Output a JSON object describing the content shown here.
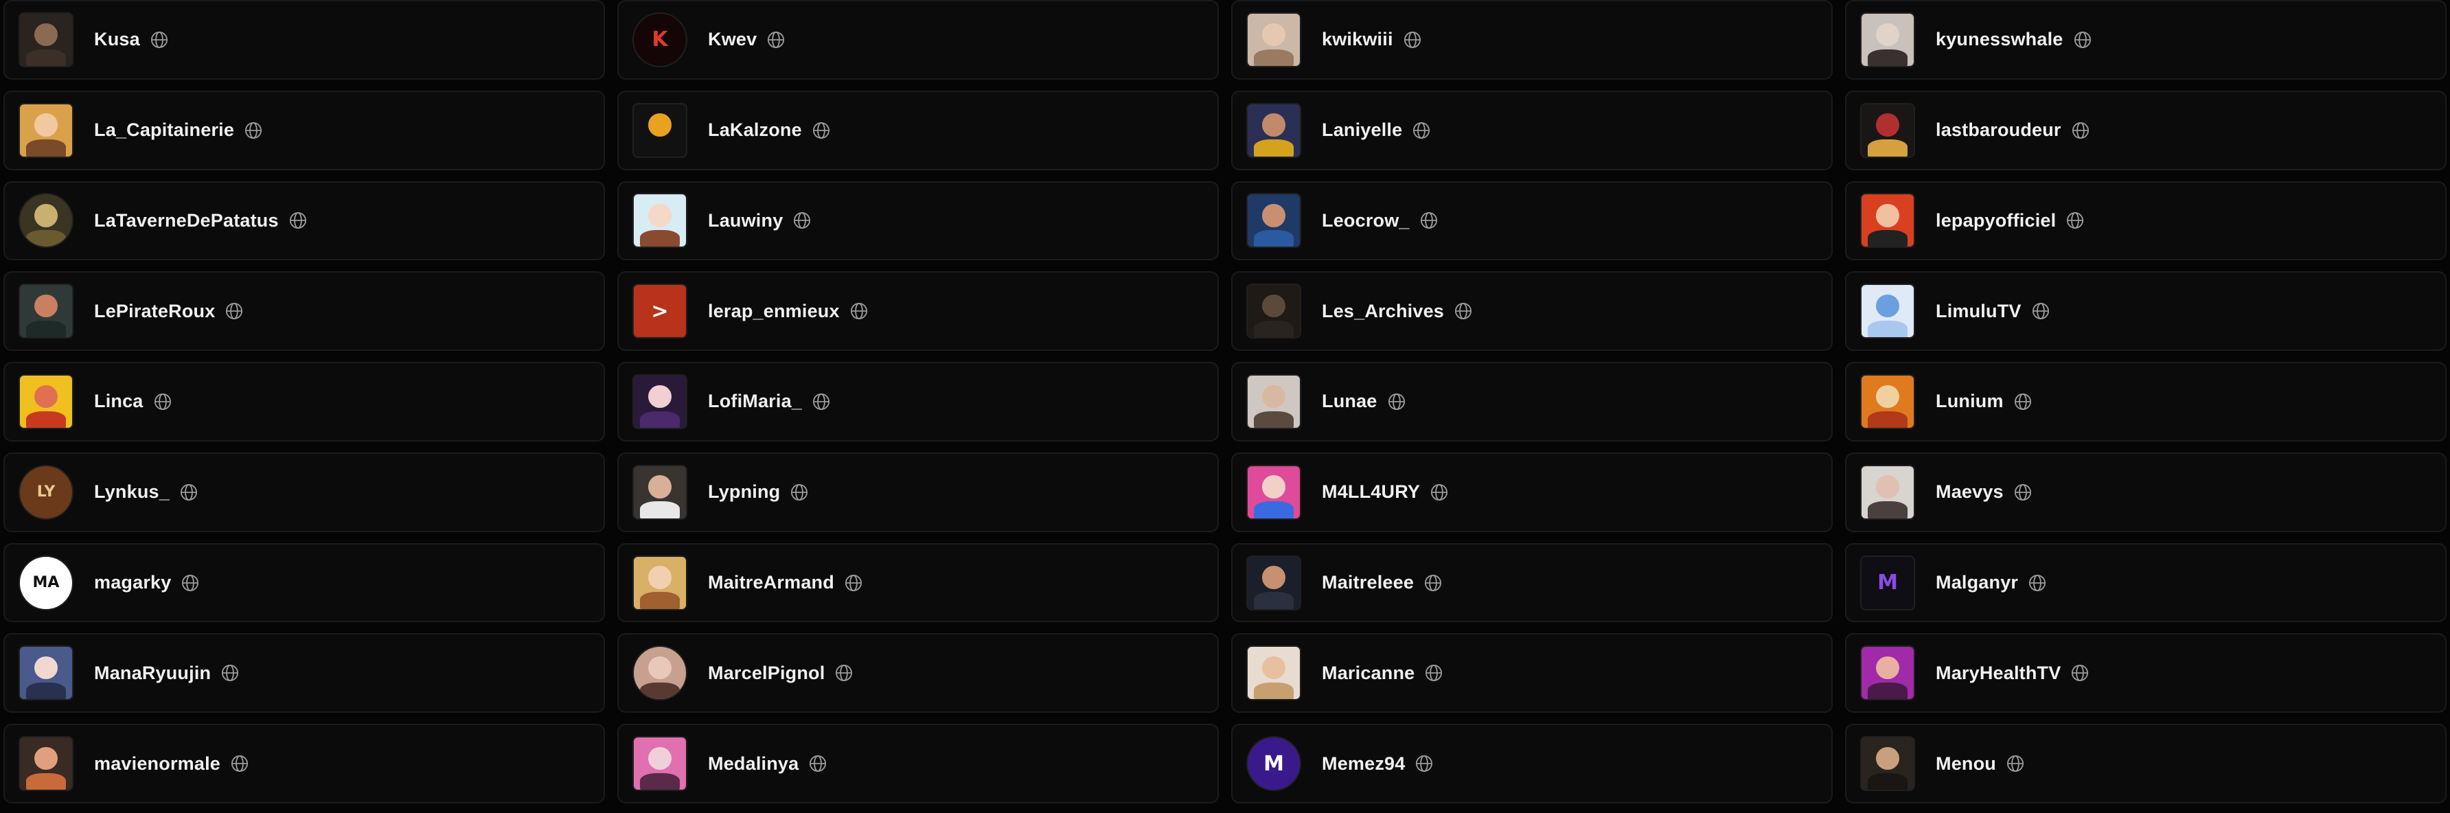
{
  "colors": {
    "page_background": "#050505",
    "card_background": "#0b0b0b",
    "card_border": "#1b1b1b",
    "text": "#f1f1f1",
    "globe_icon": "#9a9a9a"
  },
  "streamers": [
    {
      "name": "Kusa",
      "avatar": {
        "bg": "#2a2420",
        "face": "#8a6a50",
        "body": "#3b2f28",
        "round": false,
        "glyph": ""
      }
    },
    {
      "name": "Kwev",
      "avatar": {
        "bg": "#140606",
        "face": "",
        "body": "",
        "round": true,
        "glyph": "K",
        "glyph_color": "#e0392b"
      }
    },
    {
      "name": "kwikwiii",
      "avatar": {
        "bg": "#cbb8a8",
        "face": "#e6c8b0",
        "body": "#9a7b62",
        "round": false,
        "glyph": ""
      }
    },
    {
      "name": "kyunesswhale",
      "avatar": {
        "bg": "#c9c1bb",
        "face": "#e2d3c8",
        "body": "#3a3030",
        "round": false,
        "glyph": ""
      }
    },
    {
      "name": "La_Capitainerie",
      "avatar": {
        "bg": "#d9a24a",
        "face": "#f0c9a0",
        "body": "#7a4a2a",
        "round": false,
        "glyph": ""
      }
    },
    {
      "name": "LaKalzone",
      "avatar": {
        "bg": "#111111",
        "face": "#e8a21f",
        "body": "",
        "round": false,
        "glyph": ""
      }
    },
    {
      "name": "Laniyelle",
      "avatar": {
        "bg": "#2b2f55",
        "face": "#c28a6a",
        "body": "#d4a21f",
        "round": false,
        "glyph": ""
      }
    },
    {
      "name": "lastbaroudeur",
      "avatar": {
        "bg": "#1a1616",
        "face": "#b03030",
        "body": "#d4a040",
        "round": false,
        "glyph": ""
      }
    },
    {
      "name": "LaTaverneDePatatus",
      "avatar": {
        "bg": "#3a3422",
        "face": "#c8b070",
        "body": "#6a5a30",
        "round": true,
        "glyph": ""
      }
    },
    {
      "name": "Lauwiny",
      "avatar": {
        "bg": "#d8ecf4",
        "face": "#f5d8c8",
        "body": "#8a4a30",
        "round": false,
        "glyph": ""
      }
    },
    {
      "name": "Leocrow_",
      "avatar": {
        "bg": "#1f3a66",
        "face": "#c89070",
        "body": "#2a5aa0",
        "round": false,
        "glyph": ""
      }
    },
    {
      "name": "lepapyofficiel",
      "avatar": {
        "bg": "#d8401f",
        "face": "#f0c0a0",
        "body": "#222222",
        "round": false,
        "glyph": ""
      }
    },
    {
      "name": "LePirateRoux",
      "avatar": {
        "bg": "#2f3a38",
        "face": "#c88060",
        "body": "#1d2a28",
        "round": false,
        "glyph": ""
      }
    },
    {
      "name": "lerap_enmieux",
      "avatar": {
        "bg": "#b8321c",
        "face": "",
        "body": "",
        "round": false,
        "glyph": ">",
        "glyph_color": "#ffffff"
      }
    },
    {
      "name": "Les_Archives",
      "avatar": {
        "bg": "#1e1a16",
        "face": "#5a4a3a",
        "body": "#2a2420",
        "round": false,
        "glyph": ""
      }
    },
    {
      "name": "LimuluTV",
      "avatar": {
        "bg": "#dfeaf6",
        "face": "#6aa0e0",
        "body": "#a8c8f0",
        "round": false,
        "glyph": ""
      }
    },
    {
      "name": "Linca",
      "avatar": {
        "bg": "#f0c020",
        "face": "#e07050",
        "body": "#c83a20",
        "round": false,
        "glyph": ""
      }
    },
    {
      "name": "LofiMaria_",
      "avatar": {
        "bg": "#2a1a3a",
        "face": "#f0d0d0",
        "body": "#4a2a6a",
        "round": false,
        "glyph": ""
      }
    },
    {
      "name": "Lunae",
      "avatar": {
        "bg": "#cfc8c2",
        "face": "#d8b8a0",
        "body": "#5a4a40",
        "round": false,
        "glyph": ""
      }
    },
    {
      "name": "Lunium",
      "avatar": {
        "bg": "#e07a1f",
        "face": "#f0d0a0",
        "body": "#b03a1a",
        "round": false,
        "glyph": ""
      }
    },
    {
      "name": "Lynkus_",
      "avatar": {
        "bg": "#6a3a1a",
        "face": "",
        "body": "",
        "round": true,
        "glyph": "LY",
        "glyph_color": "#e8c890"
      }
    },
    {
      "name": "Lypning",
      "avatar": {
        "bg": "#3a3430",
        "face": "#d8b098",
        "body": "#e8e8e8",
        "round": false,
        "glyph": ""
      }
    },
    {
      "name": "M4LL4URY",
      "avatar": {
        "bg": "#e04a9a",
        "face": "#f0d0c8",
        "body": "#3a6ae0",
        "round": false,
        "glyph": ""
      }
    },
    {
      "name": "Maevys",
      "avatar": {
        "bg": "#d8d4d0",
        "face": "#e0c0b0",
        "body": "#4a4040",
        "round": false,
        "glyph": ""
      }
    },
    {
      "name": "magarky",
      "avatar": {
        "bg": "#ffffff",
        "face": "",
        "body": "",
        "round": true,
        "glyph": "MA",
        "glyph_color": "#111111"
      }
    },
    {
      "name": "MaitreArmand",
      "avatar": {
        "bg": "#d8b068",
        "face": "#f0d0b0",
        "body": "#a06030",
        "round": false,
        "glyph": ""
      }
    },
    {
      "name": "Maitreleee",
      "avatar": {
        "bg": "#1a1f2a",
        "face": "#c89070",
        "body": "#2a3040",
        "round": false,
        "glyph": ""
      }
    },
    {
      "name": "Malganyr",
      "avatar": {
        "bg": "#0e0e14",
        "face": "",
        "body": "",
        "round": false,
        "glyph": "M",
        "glyph_color": "#8a4ae8"
      }
    },
    {
      "name": "ManaRyuujin",
      "avatar": {
        "bg": "#4a5a8a",
        "face": "#f0d8d0",
        "body": "#2a3050",
        "round": false,
        "glyph": ""
      }
    },
    {
      "name": "MarcelPignol",
      "avatar": {
        "bg": "#c8a090",
        "face": "#e8c8b8",
        "body": "#5a3a30",
        "round": true,
        "glyph": ""
      }
    },
    {
      "name": "Maricanne",
      "avatar": {
        "bg": "#e8dcd0",
        "face": "#e8c0a0",
        "body": "#c8a070",
        "round": false,
        "glyph": ""
      }
    },
    {
      "name": "MaryHealthTV",
      "avatar": {
        "bg": "#a02aa8",
        "face": "#e8b0a0",
        "body": "#4a1a4a",
        "round": false,
        "glyph": ""
      }
    },
    {
      "name": "mavienormale",
      "avatar": {
        "bg": "#3a2a24",
        "face": "#e0a080",
        "body": "#c86a3a",
        "round": false,
        "glyph": ""
      }
    },
    {
      "name": "Medalinya",
      "avatar": {
        "bg": "#e070b0",
        "face": "#f0d0d8",
        "body": "#5a2a4a",
        "round": false,
        "glyph": ""
      }
    },
    {
      "name": "Memez94",
      "avatar": {
        "bg": "#3a1a8a",
        "face": "",
        "body": "",
        "round": true,
        "glyph": "M",
        "glyph_color": "#ffffff"
      }
    },
    {
      "name": "Menou",
      "avatar": {
        "bg": "#2a2420",
        "face": "#c8a080",
        "body": "#1a1614",
        "round": false,
        "glyph": ""
      }
    }
  ]
}
